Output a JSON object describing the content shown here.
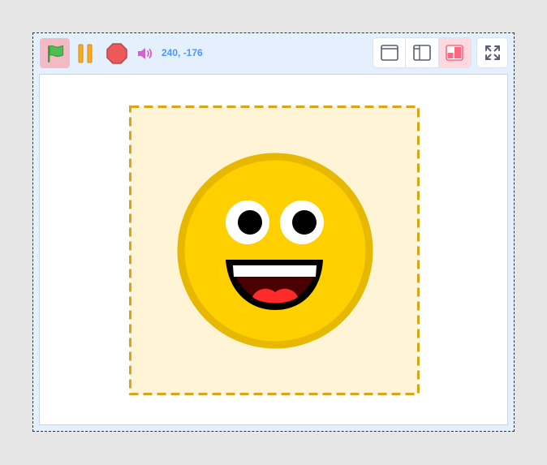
{
  "toolbar": {
    "green_flag": {
      "icon": "green-flag-icon",
      "color": "#4cbf56",
      "active_background": "#f3b9c4"
    },
    "pause": {
      "icon": "pause-icon",
      "color": "#ffab19"
    },
    "stop": {
      "icon": "stop-sign-icon",
      "color": "#ec5959"
    },
    "sound": {
      "icon": "speaker-icon",
      "color": "#cf63cf"
    },
    "coordinates": "240, -176",
    "layout_modes": [
      {
        "icon": "small-stage-icon",
        "active": false
      },
      {
        "icon": "sidebar-stage-icon",
        "active": false
      },
      {
        "icon": "large-stage-icon",
        "active": true
      }
    ],
    "fullscreen": {
      "icon": "fullscreen-icon"
    }
  },
  "stage": {
    "background": "#ffffff",
    "sprite": {
      "name_icon": "smiley-face-icon",
      "selection_border_color": "#d9a518",
      "selection_fill": "#fff5d6",
      "face_color": "#ffd000",
      "face_outline": "#e6b800"
    }
  },
  "colors": {
    "page_background": "#e6e6e6",
    "toolbar_background": "#e5f0ff",
    "accent": "#4c97ff",
    "active_layout": "#ff6680"
  }
}
